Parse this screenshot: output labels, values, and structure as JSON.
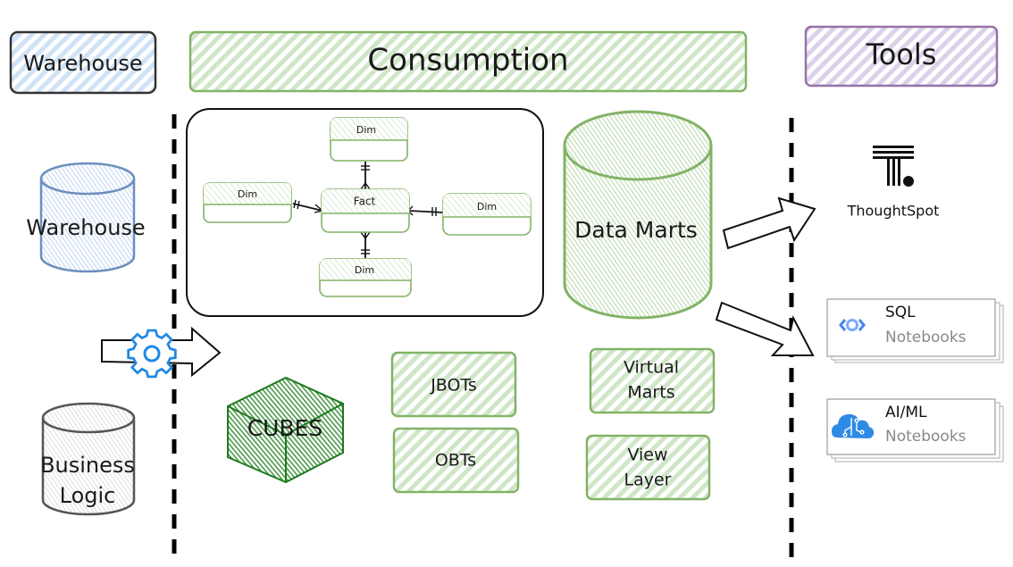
{
  "headers": {
    "warehouse": "Warehouse",
    "consumption": "Consumption",
    "tools": "Tools"
  },
  "sources": {
    "warehouse_db": "Warehouse",
    "business_logic": [
      "Business",
      "Logic"
    ]
  },
  "star_schema": {
    "fact": "Fact",
    "dims": [
      "Dim",
      "Dim",
      "Dim",
      "Dim"
    ]
  },
  "data_marts": "Data Marts",
  "cubes": "CUBES",
  "models": {
    "jbots": "JBOTs",
    "obts": "OBTs",
    "virtual_marts": [
      "Virtual",
      "Marts"
    ],
    "view_layer": [
      "View",
      "Layer"
    ]
  },
  "tools": {
    "thoughtspot": "ThoughtSpot",
    "sql_notebooks": {
      "title": "SQL",
      "subtitle": "Notebooks"
    },
    "aiml_notebooks": {
      "title": "AI/ML",
      "subtitle": "Notebooks"
    }
  },
  "colors": {
    "warehouse_blue": "#6c8ebf",
    "warehouse_fill": "#dae8fc",
    "consumption_green": "#82b366",
    "consumption_fill": "#d5e8d4",
    "tools_purple": "#9673a6",
    "tools_fill": "#e1d5e7",
    "cube_green": "#1e7a1e",
    "gear_blue": "#1e88e5",
    "grey": "#555555"
  }
}
